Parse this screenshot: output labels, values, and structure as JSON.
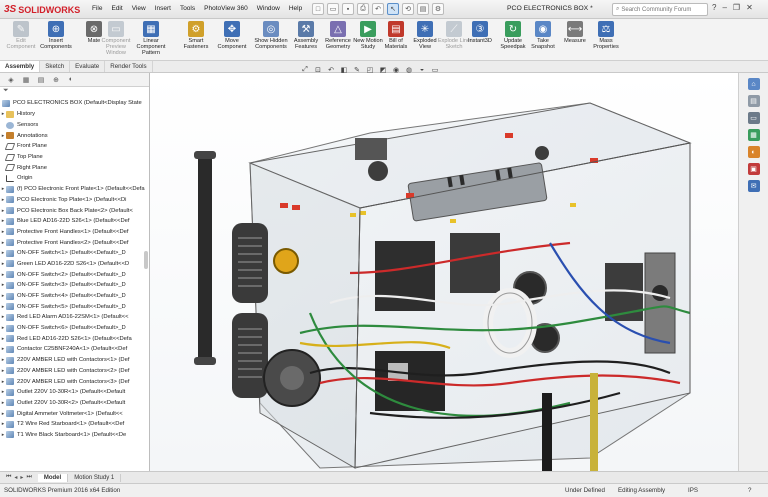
{
  "app": {
    "logo_text": "SOLIDWORKS",
    "logo_mark": "3S"
  },
  "menu": [
    "File",
    "Edit",
    "View",
    "Insert",
    "Tools",
    "PhotoView 360",
    "Window",
    "Help"
  ],
  "document_title": "PCO ELECTRONICS BOX *",
  "search": {
    "placeholder": "Search Community Forum"
  },
  "ribbon": [
    {
      "label": "Edit Component",
      "icon": "edit-component-icon",
      "enabled": false
    },
    {
      "label": "Insert Components",
      "icon": "insert-components-icon",
      "enabled": true
    },
    {
      "label": "Mate",
      "icon": "mate-icon",
      "enabled": true
    },
    {
      "label": "Component Preview Window",
      "icon": "component-preview-icon",
      "enabled": false
    },
    {
      "label": "Linear Component Pattern",
      "icon": "linear-pattern-icon",
      "enabled": true
    },
    {
      "label": "Smart Fasteners",
      "icon": "smart-fasteners-icon",
      "enabled": true
    },
    {
      "label": "Move Component",
      "icon": "move-component-icon",
      "enabled": true
    },
    {
      "label": "Show Hidden Components",
      "icon": "show-hidden-icon",
      "enabled": true
    },
    {
      "label": "Assembly Features",
      "icon": "assembly-features-icon",
      "enabled": true
    },
    {
      "label": "Reference Geometry",
      "icon": "reference-geometry-icon",
      "enabled": true
    },
    {
      "label": "New Motion Study",
      "icon": "motion-study-icon",
      "enabled": true
    },
    {
      "label": "Bill of Materials",
      "icon": "bill-of-materials-icon",
      "enabled": true
    },
    {
      "label": "Exploded View",
      "icon": "exploded-view-icon",
      "enabled": true
    },
    {
      "label": "Explode Line Sketch",
      "icon": "explode-line-icon",
      "enabled": false
    },
    {
      "label": "Instant3D",
      "icon": "instant3d-icon",
      "enabled": true
    },
    {
      "label": "Update Speedpak",
      "icon": "speedpak-icon",
      "enabled": true
    },
    {
      "label": "Take Snapshot",
      "icon": "snapshot-icon",
      "enabled": true
    },
    {
      "label": "Measure",
      "icon": "measure-icon",
      "enabled": true
    },
    {
      "label": "Mass Properties",
      "icon": "mass-properties-icon",
      "enabled": true
    }
  ],
  "command_tabs": [
    "Assembly",
    "Sketch",
    "Evaluate",
    "Render Tools"
  ],
  "active_command_tab": "Assembly",
  "tree": {
    "root": "PCO ELECTRONICS BOX  (Default<Display State",
    "items": [
      {
        "label": "History",
        "type": "folder",
        "expand": "▸"
      },
      {
        "label": "Sensors",
        "type": "sensor",
        "expand": ""
      },
      {
        "label": "Annotations",
        "type": "anno",
        "expand": "▸"
      },
      {
        "label": "Front Plane",
        "type": "plane",
        "expand": ""
      },
      {
        "label": "Top Plane",
        "type": "plane",
        "expand": ""
      },
      {
        "label": "Right Plane",
        "type": "plane",
        "expand": ""
      },
      {
        "label": "Origin",
        "type": "origin",
        "expand": ""
      },
      {
        "label": "(f) PCO Electronic Front Plate<1> (Default<<Defa",
        "type": "part",
        "expand": "▸"
      },
      {
        "label": "PCO Electronic Top Plate<1> (Default<<Di",
        "type": "part",
        "expand": "▸"
      },
      {
        "label": "PCO Electronic  Box Back Plate<2> (Default<",
        "type": "part",
        "expand": "▸"
      },
      {
        "label": "Blue LED AD16-22D S26<1> (Default<<Def",
        "type": "part",
        "expand": "▸"
      },
      {
        "label": "Protective Front Handles<1> (Default<<Def",
        "type": "part",
        "expand": "▸"
      },
      {
        "label": "Protective Front Handles<2> (Default<<Def",
        "type": "part",
        "expand": "▸"
      },
      {
        "label": "ON-OFF Switch<1> (Default<<Default>_D",
        "type": "part",
        "expand": "▸"
      },
      {
        "label": "Green LED AD16-22D S26<1> (Default<<D",
        "type": "part",
        "expand": "▸"
      },
      {
        "label": "ON-OFF Switch<2> (Default<<Default>_D",
        "type": "part",
        "expand": "▸"
      },
      {
        "label": "ON-OFF Switch<3> (Default<<Default>_D",
        "type": "part",
        "expand": "▸"
      },
      {
        "label": "ON-OFF Switch<4> (Default<<Default>_D",
        "type": "part",
        "expand": "▸"
      },
      {
        "label": "ON-OFF Switch<5> (Default<<Default>_D",
        "type": "part",
        "expand": "▸"
      },
      {
        "label": "Red LED Alarm AD16-22SM<1> (Default<<",
        "type": "part",
        "expand": "▸"
      },
      {
        "label": "ON-OFF Switch<6> (Default<<Default>_D",
        "type": "part",
        "expand": "▸"
      },
      {
        "label": "Red LED AD16-22D S26<1> (Default<<Defa",
        "type": "part",
        "expand": "▸"
      },
      {
        "label": "Contactor C25BNF240A<1> (Default<<Def",
        "type": "part",
        "expand": "▸"
      },
      {
        "label": "220V AMBER LED with Contactors<1> (Def",
        "type": "part",
        "expand": "▸"
      },
      {
        "label": "220V AMBER LED with Contactors<2> (Def",
        "type": "part",
        "expand": "▸"
      },
      {
        "label": "220V AMBER LED with Contactors<3> (Def",
        "type": "part",
        "expand": "▸"
      },
      {
        "label": "Outlet 220V 10-30R<1> (Default<<Default",
        "type": "part",
        "expand": "▸"
      },
      {
        "label": "Outlet 220V 10-30R<2> (Default<<Default",
        "type": "part",
        "expand": "▸"
      },
      {
        "label": "Digital Ammeter Voltmeter<1> (Default<<",
        "type": "part",
        "expand": "▸"
      },
      {
        "label": "T2 Wire Red Starboard<1> (Default<<Def",
        "type": "part",
        "expand": "▸"
      },
      {
        "label": "T1 Wire Black Starboard<1> (Default<<De",
        "type": "part",
        "expand": "▸"
      }
    ]
  },
  "bottom_tabs": [
    "Model",
    "Motion Study 1"
  ],
  "status": {
    "edition": "SOLIDWORKS Premium 2016 x64 Edition",
    "state": "Under Defined",
    "mode": "Editing Assembly",
    "units": "IPS"
  },
  "colors": {
    "brand": "#d2202a",
    "accent": "#3a6fb0"
  }
}
